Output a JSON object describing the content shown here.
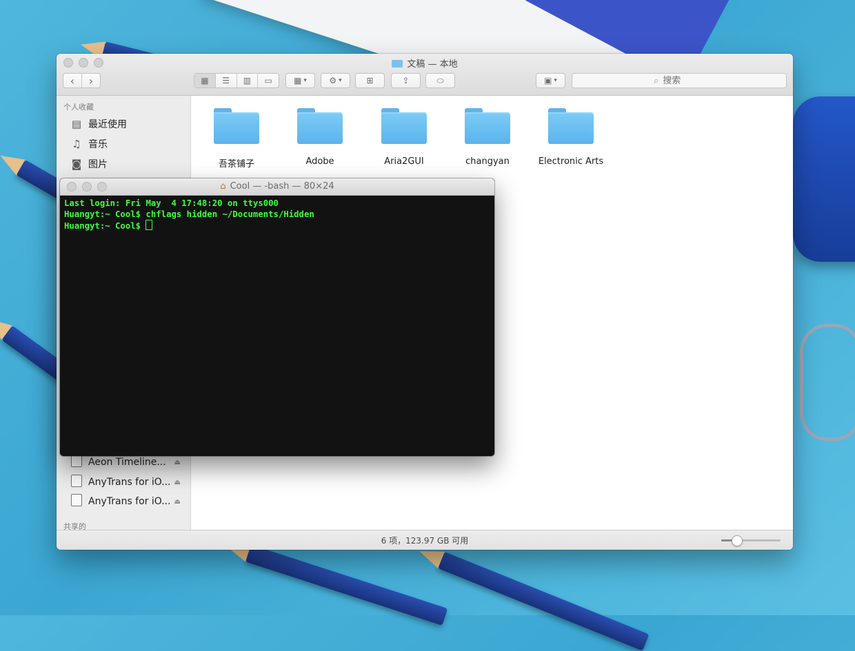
{
  "finder": {
    "title": "文稿 — 本地",
    "search_placeholder": "搜索",
    "sidebar": {
      "favorites_header": "个人收藏",
      "favorites": [
        {
          "label": "最近使用",
          "icon": "recents-icon"
        },
        {
          "label": "音乐",
          "icon": "music-icon"
        },
        {
          "label": "图片",
          "icon": "pictures-icon"
        }
      ],
      "devices": [
        {
          "label": "Aeon Timeline..."
        },
        {
          "label": "AnyTrans for iO..."
        },
        {
          "label": "AnyTrans for iO..."
        }
      ],
      "shared_header": "共享的"
    },
    "files": [
      {
        "label": "吾茶铺子"
      },
      {
        "label": "Adobe"
      },
      {
        "label": "Aria2GUI"
      },
      {
        "label": "changyan"
      },
      {
        "label": "Electronic Arts"
      }
    ],
    "status": "6 项，123.97 GB 可用",
    "icon_size_fraction": 0.25
  },
  "terminal": {
    "title": "Cool — -bash — 80×24",
    "lines": [
      "Last login: Fri May  4 17:48:20 on ttys000",
      "Huangyt:~ Cool$ chflags hidden ~/Documents/Hidden",
      "Huangyt:~ Cool$ "
    ]
  }
}
